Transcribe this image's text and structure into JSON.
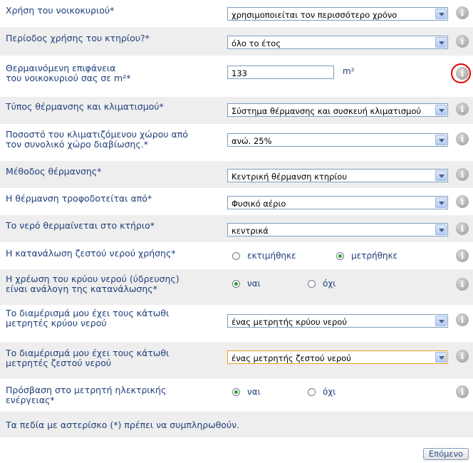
{
  "rows": [
    {
      "label": "Χρήση του νοικοκυριού*",
      "value": "χρησιμοποιείται τον περισσότερο χρόνο"
    },
    {
      "label": "Περίοδος χρήσης του κτηρίου?*",
      "value": "όλο το έτος"
    },
    {
      "label": "Θερμαινόμενη επιφάνεια\nτου νοικοκυριού σας σε m²*",
      "value": "133",
      "unit": "m²"
    },
    {
      "label": "Τύπος θέρμανσης και κλιματισμού*",
      "value": "Σύστημα θέρμανσης και συσκευή κλιματισμού"
    },
    {
      "label": "Ποσοστό του κλιματιζόμενου χώρου από\nτον συνολικό χώρο διαβίωσης.*",
      "value": "ανώ. 25%"
    },
    {
      "label": "Μέθοδος θέρμανσης*",
      "value": "Κεντρική θέρμανση κτηρίου"
    },
    {
      "label": "Η θέρμανση τροφοδοτείται από*",
      "value": "Φυσικό αέριο"
    },
    {
      "label": "Το νερό θερμαίνεται στο κτήριο*",
      "value": "κεντρικά"
    },
    {
      "label": "Η κατανάλωση ζεστού νερού χρήσης*",
      "options": [
        "εκτιμήθηκε",
        "μετρήθηκε"
      ],
      "selected": 1
    },
    {
      "label": "Η χρέωση του κρύου νερού (ύδρευσης)\nείναι ανάλογη της κατανάλωσης*",
      "options": [
        "ναι",
        "όχι"
      ],
      "selected": 0
    },
    {
      "label": "Το διαμέρισμά μου έχει τους κάτωθι\nμετρητές κρύου νερού",
      "value": "ένας μετρητής κρύου νερού"
    },
    {
      "label": "Το διαμέρισμά μου έχει τους κάτωθι\nμετρητές ζεστού νερού",
      "value": "ένας μετρητής ζεστού νερού"
    },
    {
      "label": "Πρόσβαση στο μετρητή ηλεκτρικής\nενέργειας*",
      "options": [
        "ναι",
        "όχι"
      ],
      "selected": 0
    }
  ],
  "note": "Τα πεδία με αστερίσκο (*) πρέπει να συμπληρωθούν.",
  "next_label": "Επόμενο",
  "info_glyph": "i",
  "icons": {
    "info": "info-icon"
  },
  "colors": {
    "label": "#1f3f7a",
    "shade": "#eeeeee",
    "highlight": "#e00000",
    "focus": "#e3a21a",
    "radio_on": "#27a12a"
  }
}
